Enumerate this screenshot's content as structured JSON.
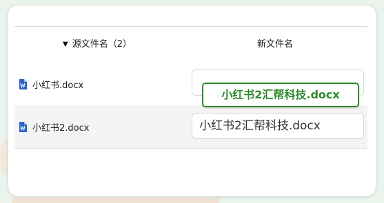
{
  "dialog": {
    "title_partial": "",
    "header": {
      "source_column": "源文件名（2）",
      "new_column": "新文件名"
    },
    "rows": [
      {
        "source_name": "小红书.docx",
        "new_name": "",
        "icon": "word-doc-icon"
      },
      {
        "source_name": "小红书2.docx",
        "new_name": "小红书2汇帮科技.docx",
        "icon": "word-doc-icon"
      }
    ],
    "tooltip_text": "小红书2汇帮科技.docx"
  },
  "colors": {
    "accent_green": "#2f8a2f",
    "word_blue": "#2b63c6",
    "row_highlight": "#f4f4f4"
  }
}
